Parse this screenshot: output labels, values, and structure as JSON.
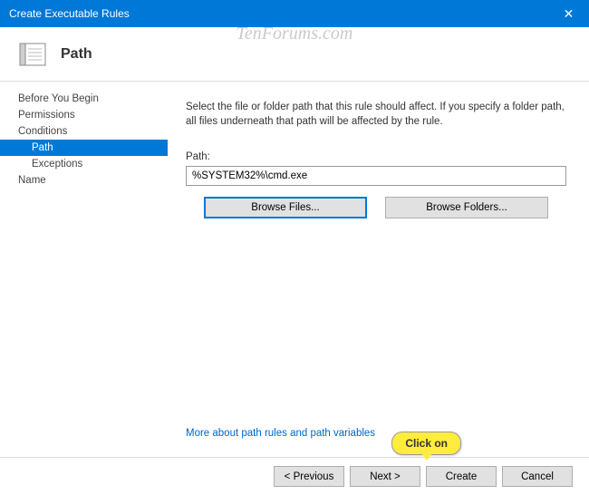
{
  "window": {
    "title": "Create Executable Rules"
  },
  "header": {
    "title": "Path"
  },
  "sidebar": {
    "items": [
      {
        "label": "Before You Begin"
      },
      {
        "label": "Permissions"
      },
      {
        "label": "Conditions"
      },
      {
        "label": "Path"
      },
      {
        "label": "Exceptions"
      },
      {
        "label": "Name"
      }
    ]
  },
  "main": {
    "description": "Select the file or folder path that this rule should affect. If you specify a folder path, all files underneath that path will be affected by the rule.",
    "path_label": "Path:",
    "path_value": "%SYSTEM32%\\cmd.exe",
    "browse_files_label": "Browse Files...",
    "browse_folders_label": "Browse Folders...",
    "help_link": "More about path rules and path variables"
  },
  "footer": {
    "previous": "< Previous",
    "next": "Next >",
    "create": "Create",
    "cancel": "Cancel"
  },
  "watermark": "TenForums.com",
  "callout": "Click on"
}
